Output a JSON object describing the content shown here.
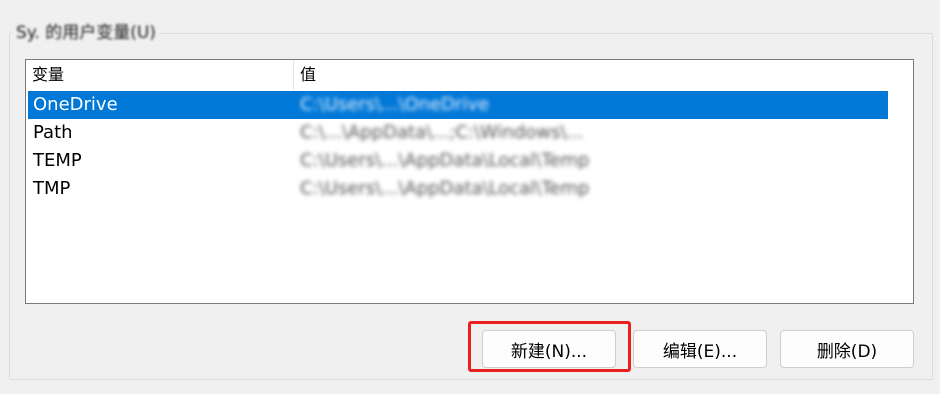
{
  "group": {
    "title": "Sy. 的用户变量(U)"
  },
  "table": {
    "columns": [
      "变量",
      "值"
    ],
    "rows": [
      {
        "name": "OneDrive",
        "value": "C:\\Users\\...\\OneDrive",
        "selected": true
      },
      {
        "name": "Path",
        "value": "C:\\...\\AppData\\...;C:\\Windows\\...",
        "selected": false
      },
      {
        "name": "TEMP",
        "value": "C:\\Users\\...\\AppData\\Local\\Temp",
        "selected": false
      },
      {
        "name": "TMP",
        "value": "C:\\Users\\...\\AppData\\Local\\Temp",
        "selected": false
      }
    ]
  },
  "buttons": {
    "new": "新建(N)...",
    "edit": "编辑(E)...",
    "delete": "删除(D)"
  },
  "colors": {
    "selection": "#0078d7",
    "highlight_box": "#e8201e"
  }
}
